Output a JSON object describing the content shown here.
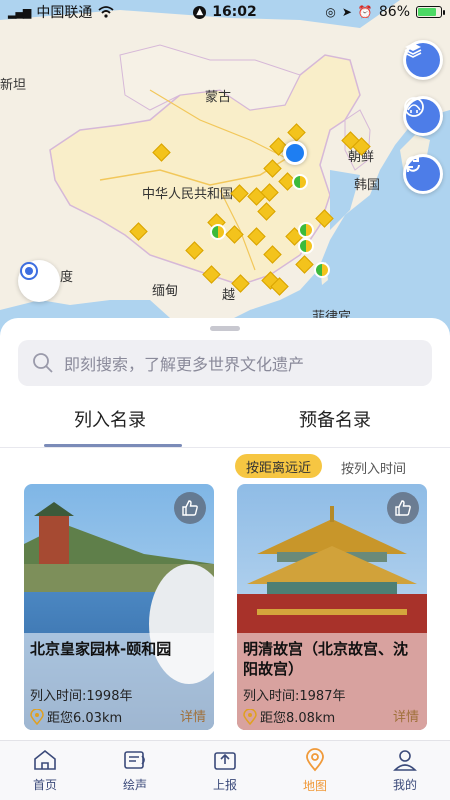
{
  "status_bar": {
    "carrier": "中国联通",
    "time": "16:02",
    "battery": "86%",
    "battery_level": 0.86
  },
  "map": {
    "labels": {
      "mongolia": "蒙古",
      "china": "中华人民共和国",
      "korea_north": "朝鲜",
      "korea_south": "韩国",
      "myanmar": "缅甸",
      "vietnam": "越",
      "philippines": "菲律宾",
      "xinjiang_edge": "新坦",
      "india_edge": "度"
    },
    "buttons": {
      "layers": "layers-icon",
      "heritage": "heritage-icon",
      "refresh": "refresh-icon",
      "locate": "locate-icon"
    }
  },
  "search": {
    "placeholder": "即刻搜索，了解更多世界文化遗产"
  },
  "tabs": [
    {
      "label": "列入名录",
      "active": true
    },
    {
      "label": "预备名录",
      "active": false
    }
  ],
  "sort": {
    "by_distance": "按距离远近",
    "by_time": "按列入时间",
    "active": "by_distance"
  },
  "cards": [
    {
      "title": "北京皇家园林-颐和园",
      "date": "列入时间:1998年",
      "distance": "距您6.03km",
      "more": "详情"
    },
    {
      "title": "明清故宫（北京故宫、沈阳故宫）",
      "date": "列入时间:1987年",
      "distance": "距您8.08km",
      "more": "详情"
    }
  ],
  "nav": [
    {
      "label": "首页",
      "icon": "home-icon",
      "active": false
    },
    {
      "label": "绘声",
      "icon": "audio-icon",
      "active": false
    },
    {
      "label": "上报",
      "icon": "upload-icon",
      "active": false
    },
    {
      "label": "地图",
      "icon": "map-pin-icon",
      "active": true
    },
    {
      "label": "我的",
      "icon": "user-icon",
      "active": false
    }
  ],
  "colors": {
    "accent": "#f09a3a",
    "nav_text": "#3b4a7a",
    "sort_pill": "#f6c642",
    "map_button": "#4d7de8"
  }
}
